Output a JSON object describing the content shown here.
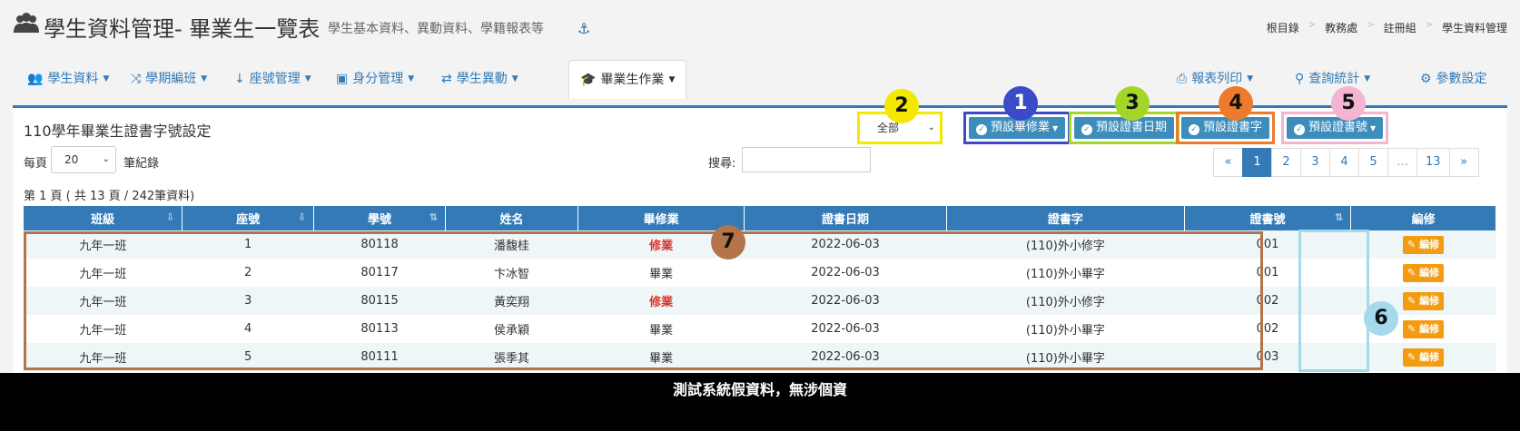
{
  "header": {
    "title": "學生資料管理- 畢業生一覽表",
    "subtitle": "學生基本資料、異動資料、學籍報表等",
    "breadcrumb": [
      "根目錄",
      "教務處",
      "註冊組",
      "學生資料管理"
    ]
  },
  "nav": {
    "tabs": [
      {
        "label": "學生資料"
      },
      {
        "label": "學期編班"
      },
      {
        "label": "座號管理"
      },
      {
        "label": "身分管理"
      },
      {
        "label": "學生異動"
      },
      {
        "label": "畢業生作業"
      }
    ],
    "right": [
      {
        "label": "報表列印"
      },
      {
        "label": "查詢統計"
      },
      {
        "label": "參數設定"
      }
    ]
  },
  "panel": {
    "title": "110學年畢業生證書字號設定",
    "filter_value": "全部",
    "actions": {
      "graduate": "預設畢修業",
      "cert_date": "預設證書日期",
      "cert_word": "預設證書字",
      "cert_no": "預設證書號"
    },
    "markers": [
      "1",
      "2",
      "3",
      "4",
      "5",
      "6",
      "7"
    ],
    "per_page_prefix": "每頁",
    "per_page_value": "20",
    "per_page_suffix": "筆紀錄",
    "search_label": "搜尋:",
    "pager": [
      "«",
      "1",
      "2",
      "3",
      "4",
      "5",
      "…",
      "13",
      "»"
    ],
    "info": "第 1 頁 ( 共 13 頁 / 242筆資料)"
  },
  "table": {
    "headers": [
      "班級",
      "座號",
      "學號",
      "姓名",
      "畢修業",
      "證書日期",
      "證書字",
      "證書號",
      "編修"
    ],
    "edit_label": "編修",
    "rows": [
      {
        "class": "九年一班",
        "seat": "1",
        "id": "80118",
        "name": "潘馥桂",
        "status": "修業",
        "date": "2022-06-03",
        "word": "(110)外小修字",
        "no": "001"
      },
      {
        "class": "九年一班",
        "seat": "2",
        "id": "80117",
        "name": "卞冰智",
        "status": "畢業",
        "date": "2022-06-03",
        "word": "(110)外小畢字",
        "no": "001"
      },
      {
        "class": "九年一班",
        "seat": "3",
        "id": "80115",
        "name": "黃奕翔",
        "status": "修業",
        "date": "2022-06-03",
        "word": "(110)外小修字",
        "no": "002"
      },
      {
        "class": "九年一班",
        "seat": "4",
        "id": "80113",
        "name": "侯承穎",
        "status": "畢業",
        "date": "2022-06-03",
        "word": "(110)外小畢字",
        "no": "002"
      },
      {
        "class": "九年一班",
        "seat": "5",
        "id": "80111",
        "name": "張季其",
        "status": "畢業",
        "date": "2022-06-03",
        "word": "(110)外小畢字",
        "no": "003"
      }
    ]
  },
  "footer": {
    "text": "測試系統假資料，無涉個資"
  },
  "colors": {
    "primary": "#337ab7",
    "button": "#3c8dbc",
    "edit": "#f39c12",
    "marker1": "#3b4bc8",
    "marker2": "#f4e700",
    "marker3": "#a4d62a",
    "marker4": "#ee7a2b",
    "marker5": "#f3b5cf",
    "marker6": "#a5d9ec",
    "marker7": "#b5734a"
  }
}
